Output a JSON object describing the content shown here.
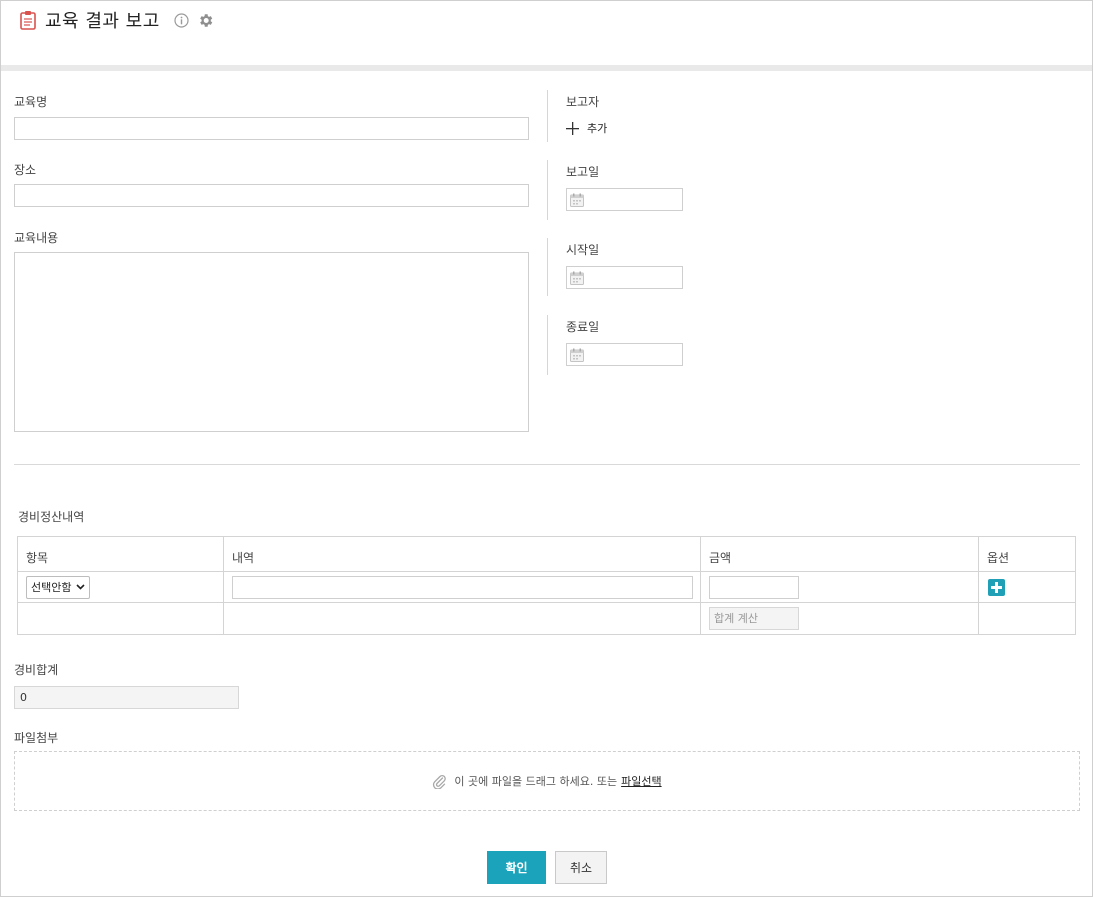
{
  "header": {
    "title": "교육 결과 보고",
    "icons": [
      "document-icon",
      "info-icon",
      "gear-icon"
    ]
  },
  "form": {
    "course_name_label": "교육명",
    "location_label": "장소",
    "content_label": "교육내용",
    "reporter_label": "보고자",
    "reporter_add": "추가",
    "report_date_label": "보고일",
    "start_date_label": "시작일",
    "end_date_label": "종료일"
  },
  "expense": {
    "section_label": "경비정산내역",
    "columns": [
      "항목",
      "내역",
      "금액",
      "옵션"
    ],
    "row": {
      "item_select": "선택안함"
    },
    "sum_button": "합계 계산",
    "total_label": "경비합계",
    "total_value": "0"
  },
  "attachment": {
    "label": "파일첨부",
    "drop_text": "이 곳에 파일을 드래그 하세요. 또는",
    "select_link": "파일선택"
  },
  "buttons": {
    "confirm": "확인",
    "cancel": "취소"
  },
  "colors": {
    "accent": "#1aa3ba",
    "title_icon": "#e85a4f"
  }
}
